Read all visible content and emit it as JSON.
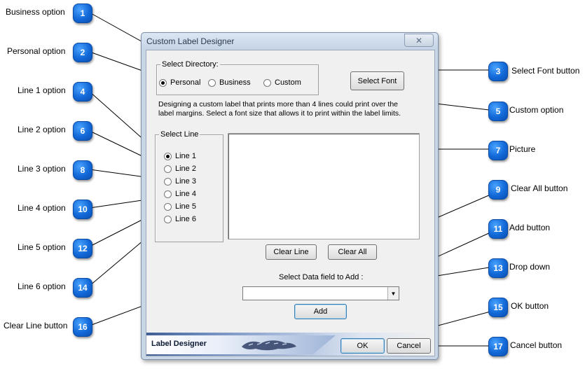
{
  "window": {
    "title": "Custom Label Designer",
    "close_label": "✕"
  },
  "directory": {
    "legend": "Select Directory:",
    "options": [
      {
        "label": "Personal",
        "checked": true
      },
      {
        "label": "Business",
        "checked": false
      },
      {
        "label": "Custom",
        "checked": false
      }
    ]
  },
  "buttons": {
    "select_font": "Select Font",
    "clear_line": "Clear Line",
    "clear_all": "Clear All",
    "add": "Add",
    "ok": "OK",
    "cancel": "Cancel"
  },
  "info_text": {
    "line1": "Designing a custom label that prints more than 4 lines could print over the",
    "line2": "label margins. Select a font size that allows it to print within the label limits."
  },
  "select_line": {
    "legend": "Select Line",
    "options": [
      {
        "label": "Line 1",
        "checked": true
      },
      {
        "label": "Line 2",
        "checked": false
      },
      {
        "label": "Line 3",
        "checked": false
      },
      {
        "label": "Line 4",
        "checked": false
      },
      {
        "label": "Line 5",
        "checked": false
      },
      {
        "label": "Line 6",
        "checked": false
      }
    ]
  },
  "data_field": {
    "label": "Select Data field to Add :",
    "value": ""
  },
  "banner": {
    "title": "Label Designer"
  },
  "annotations": [
    {
      "num": "1",
      "label": "Business option"
    },
    {
      "num": "2",
      "label": "Personal option"
    },
    {
      "num": "3",
      "label": "Select Font button"
    },
    {
      "num": "4",
      "label": "Line 1 option"
    },
    {
      "num": "5",
      "label": "Custom option"
    },
    {
      "num": "6",
      "label": "Line 2 option"
    },
    {
      "num": "7",
      "label": "Picture"
    },
    {
      "num": "8",
      "label": "Line 3 option"
    },
    {
      "num": "9",
      "label": "Clear All button"
    },
    {
      "num": "10",
      "label": "Line 4 option"
    },
    {
      "num": "11",
      "label": "Add button"
    },
    {
      "num": "12",
      "label": "Line 5 option"
    },
    {
      "num": "13",
      "label": "Drop down"
    },
    {
      "num": "14",
      "label": "Line 6 option"
    },
    {
      "num": "15",
      "label": "OK button"
    },
    {
      "num": "16",
      "label": "Clear Line button"
    },
    {
      "num": "17",
      "label": "Cancel button"
    }
  ]
}
